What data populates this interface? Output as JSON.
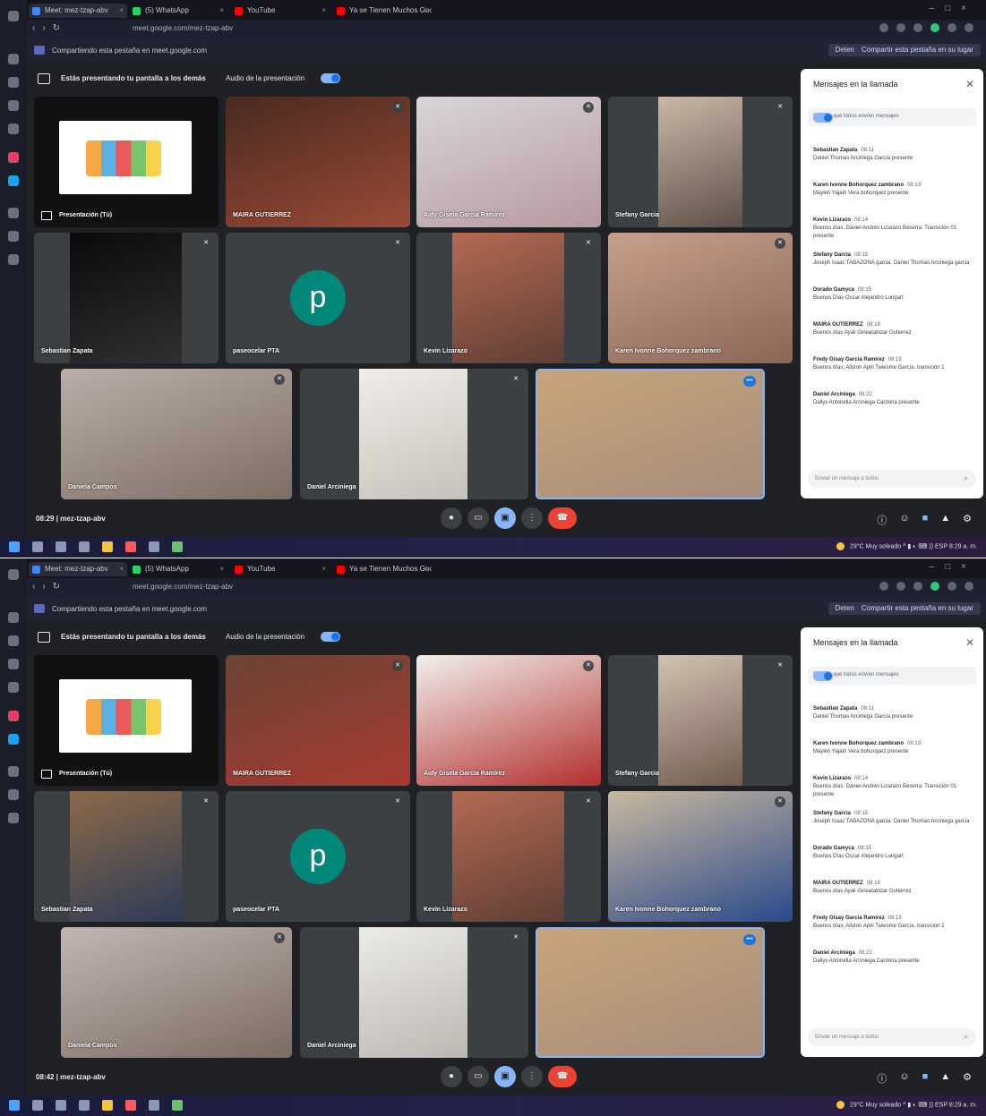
{
  "browser": {
    "tabs": [
      {
        "label": "Meet: mez-tzap-abv",
        "fav": "#4285f4"
      },
      {
        "label": "(5) WhatsApp",
        "fav": "#25d366"
      },
      {
        "label": "YouTube",
        "fav": "#ff0000"
      },
      {
        "label": "Ya se Tienen Muchos Goos",
        "fav": "#ff0000"
      }
    ],
    "url": "meet.google.com/mez-tzap-abv",
    "share_notice": "Compartiendo esta pestaña en meet.google.com",
    "stop_label": "Detener",
    "share_instead_label": "Compartir esta pestaña en su lugar"
  },
  "meet": {
    "presenting_text": "Estás presentando tu pantalla a los demás",
    "audio_label": "Audio de la presentación",
    "meeting_code": "mez-tzap-abv",
    "presentation_label": "Presentación (Tú)"
  },
  "screens": [
    {
      "time": "08:29",
      "tiles": [
        {
          "name": "MAIRA GUTIERREZ",
          "colors": [
            "#4a2a22",
            "#9a4a36"
          ]
        },
        {
          "name": "Aidy Gisela Garcia Ramírez",
          "colors": [
            "#d9d5d6",
            "#b59aa0"
          ]
        },
        {
          "name": "Stefany Garcia",
          "colors": [
            "#c9b8a8",
            "#5e514a"
          ]
        },
        {
          "name": "Sebastian Zapata",
          "colors": [
            "#0a0a0a",
            "#303030"
          ]
        },
        {
          "name": "paseocelar PTA",
          "avatar": "p"
        },
        {
          "name": "Kevin Lizarazo",
          "colors": [
            "#b46a53",
            "#5f3e35"
          ]
        },
        {
          "name": "Karen Ivonne Bohorquez zambrano",
          "colors": [
            "#c7a08d",
            "#8b6656"
          ]
        },
        {
          "name": "Daniela Campos",
          "colors": [
            "#b9aea8",
            "#7d6e65"
          ]
        },
        {
          "name": "Daniel Arciniega",
          "colors": [
            "#f0ede8",
            "#c7c1bb"
          ]
        },
        {
          "name": "",
          "colors": [
            "#c8a47a",
            "#a58d7c"
          ]
        }
      ]
    },
    {
      "time": "08:42",
      "tiles": [
        {
          "name": "MAIRA GUTIERREZ",
          "colors": [
            "#6b4436",
            "#a73a31"
          ]
        },
        {
          "name": "Aidy Gisela Garcia Ramírez",
          "colors": [
            "#f1efec",
            "#b3302f"
          ]
        },
        {
          "name": "Stefany Garcia",
          "colors": [
            "#d2c2b4",
            "#6f5d50"
          ]
        },
        {
          "name": "Sebastian Zapata",
          "colors": [
            "#8c6a49",
            "#2d3b57"
          ]
        },
        {
          "name": "paseocelar PTA",
          "avatar": "p"
        },
        {
          "name": "Kevin Lizarazo",
          "colors": [
            "#b46a53",
            "#5f3e35"
          ]
        },
        {
          "name": "Karen Ivonne Bohorquez zambrano",
          "colors": [
            "#c9b8a0",
            "#2a4a8a"
          ]
        },
        {
          "name": "Daniela Campos",
          "colors": [
            "#c2b6b3",
            "#7a6c62"
          ]
        },
        {
          "name": "Daniel Arciniega",
          "colors": [
            "#ecebe8",
            "#bdb7b1"
          ]
        },
        {
          "name": "",
          "colors": [
            "#c8a47a",
            "#a58d7c"
          ]
        }
      ]
    }
  ],
  "chat": {
    "title": "Mensajes en la llamada",
    "allow_label": "Permitir que todos envíen mensajes",
    "input_placeholder": "Enviar un mensaje a todos",
    "messages": [
      {
        "sender": "Sebastian Zapata",
        "time": "08:11",
        "body": "Daniel Thomas Arciniega García presente"
      },
      {
        "sender": "Karen Ivonne Bohorquez zambrano",
        "time": "08:13",
        "body": "Maylen Yajaíri Vera bohorquez presente"
      },
      {
        "sender": "Kevin Lizarazo",
        "time": "08:14",
        "body": "Buenos días. Daniel Andrés Lizarazo Beserra. Transición 01 presente"
      },
      {
        "sender": "Stefany Garcia",
        "time": "08:15",
        "body": "Joseph Isaac TABAZONA garcia. Daniel Thomas Arciniega garcia"
      },
      {
        "sender": "Dorado Gamyca",
        "time": "08:15",
        "body": "Buenos Días Oscar Alejandro Lungart"
      },
      {
        "sender": "MAIRA GUTIERREZ",
        "time": "08:18",
        "body": "Buenos días Ayali Gineatabizar Gutierrez"
      },
      {
        "sender": "Fredy Gisay Garcia Ramírez",
        "time": "08:19",
        "body": "Buenos días, Aliston April Twiesme García. transición 1"
      },
      {
        "sender": "Daniel Arciniega",
        "time": "08:22",
        "body": "Dallys Antonella Arciniega Cardona presente"
      }
    ]
  },
  "taskbar": {
    "weather": "29°C Muy soleado",
    "lang": "ESP",
    "clock": "8:29 a. m."
  },
  "colors": {
    "meet_bg": "#202124",
    "tile_bg": "#3c4043",
    "accent": "#8ab4f8",
    "end_call": "#ea4335",
    "avatar": "#00897b"
  }
}
